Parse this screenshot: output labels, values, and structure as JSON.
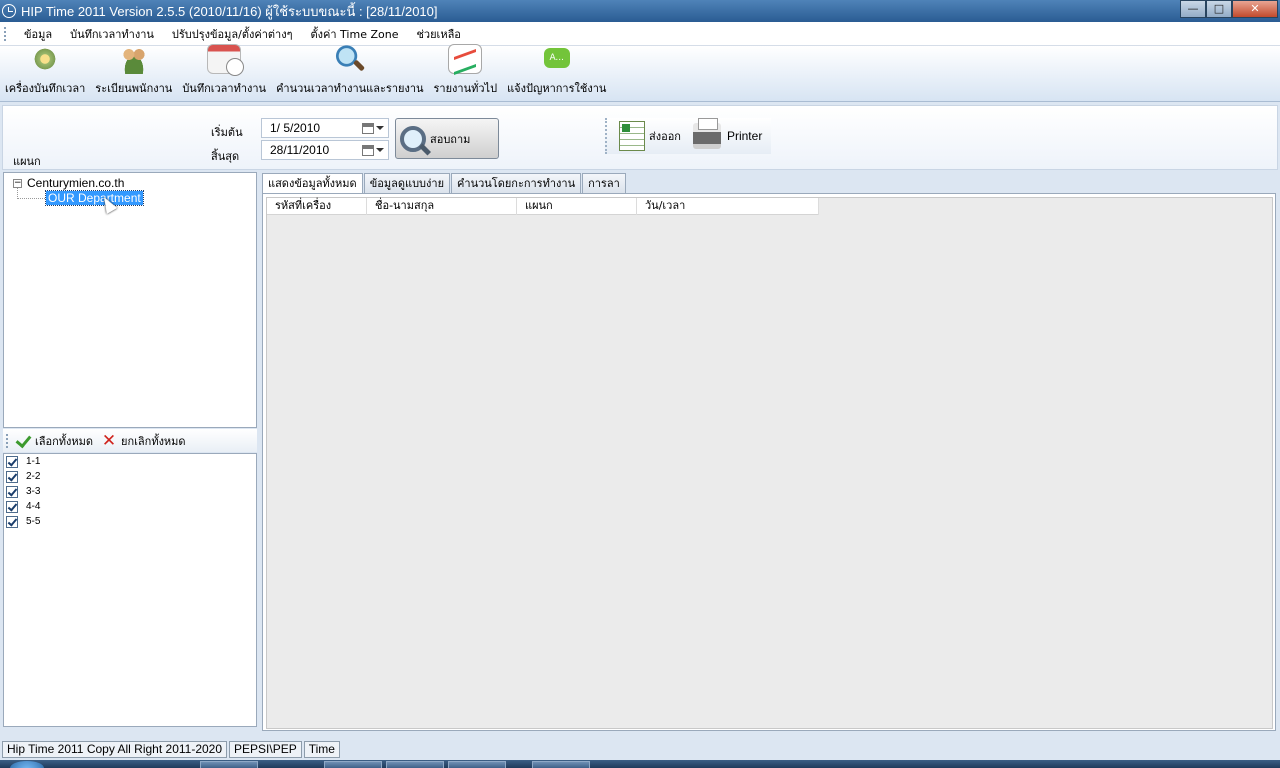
{
  "window": {
    "title": "HIP Time 2011 Version 2.5.5 (2010/11/16)  ผู้ใช้ระบบขณะนี้  :  [28/11/2010]",
    "min_label": "—",
    "max_label": "□",
    "close_label": "✕"
  },
  "menu": [
    {
      "label": "ข้อมูล"
    },
    {
      "label": "บันทึกเวลาทำงาน"
    },
    {
      "label": "ปรับปรุงข้อมูล/ตั้งค่าต่างๆ"
    },
    {
      "label": "ตั้งค่า Time Zone"
    },
    {
      "label": "ช่วยเหลือ"
    }
  ],
  "toolbar": [
    {
      "label": "เครื่องบันทึกเวลา",
      "icon": "gear-machine-icon"
    },
    {
      "label": "ระเบียนพนักงาน",
      "icon": "people-icon"
    },
    {
      "label": "บันทึกเวลาทำงาน",
      "icon": "calendar-clock-icon"
    },
    {
      "label": "คำนวนเวลาทำงานและรายงาน",
      "icon": "magnifier-icon"
    },
    {
      "label": "รายงานทั่วไป",
      "icon": "report-chart-icon"
    },
    {
      "label": "แจ้งปัญหาการใช้งาน",
      "icon": "chat-bubble-icon",
      "icon_text": "A..."
    }
  ],
  "filter": {
    "department_label": "แผนก",
    "start_label": "เริ่มต้น",
    "end_label": "สิ้นสุด",
    "start_date": "1/  5/2010",
    "end_date": "28/11/2010",
    "query_button": "สอบถาม",
    "export_button": "ส่งออก",
    "printer_button": "Printer"
  },
  "tree": {
    "root": "Centurymien.co.th",
    "children": [
      "OUR Department"
    ],
    "selected": "OUR Department"
  },
  "select_toolbar": {
    "select_all": "เลือกทั้งหมด",
    "deselect_all": "ยกเลิกทั้งหมด"
  },
  "checklist": [
    {
      "label": "1-1",
      "checked": true
    },
    {
      "label": "2-2",
      "checked": true
    },
    {
      "label": "3-3",
      "checked": true
    },
    {
      "label": "4-4",
      "checked": true
    },
    {
      "label": "5-5",
      "checked": true
    }
  ],
  "tabs": [
    {
      "label": "แสดงข้อมูลทั้งหมด",
      "active": true
    },
    {
      "label": "ข้อมูลดูแบบง่าย",
      "active": false
    },
    {
      "label": "คำนวนโดยกะการทำงาน",
      "active": false
    },
    {
      "label": "การลา",
      "active": false
    }
  ],
  "grid": {
    "columns": [
      "รหัสที่เครื่อง",
      "ชื่อ-นามสกุล",
      "แผนก",
      "วัน/เวลา"
    ],
    "rows": []
  },
  "statusbar": [
    "Hip Time 2011 Copy All Right 2011-2020",
    "PEPSI\\PEP",
    "Time"
  ]
}
